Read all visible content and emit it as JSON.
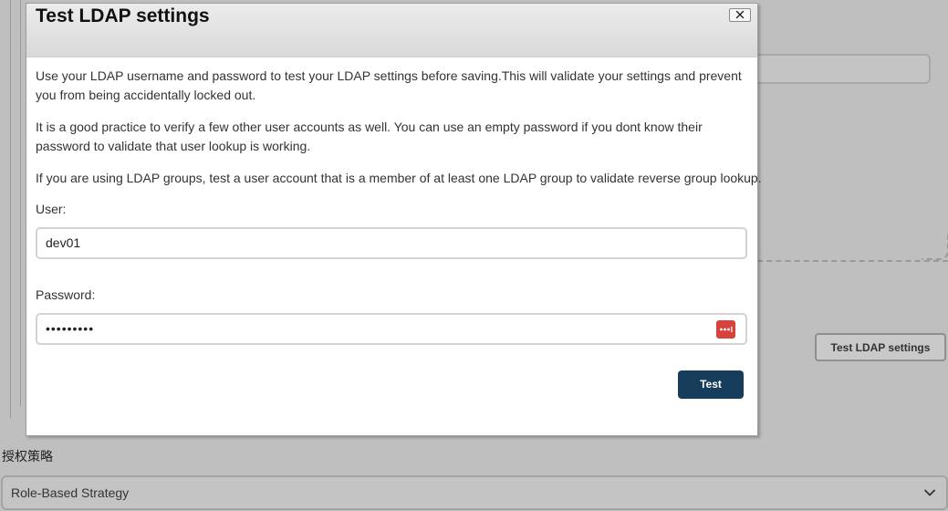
{
  "background": {
    "test_ldap_button_label": "Test LDAP settings",
    "authorization_label": "授权策略",
    "authorization_select_value": "Role-Based Strategy"
  },
  "dialog": {
    "title": "Test LDAP settings",
    "close_label": "✕",
    "paragraphs": {
      "p1": "Use your LDAP username and password to test your LDAP settings before saving.This will validate your settings and prevent you from being accidentally locked out.",
      "p2": "It is a good practice to verify a few other user accounts as well. You can use an empty password if you dont know their password to validate that user lookup is working.",
      "p3": "If you are using LDAP groups, test a user account that is a member of at least one LDAP group to validate reverse group lookup."
    },
    "user_label": "User:",
    "user_value": "dev01",
    "password_label": "Password:",
    "password_value": "•••••••••",
    "test_button_label": "Test"
  },
  "colors": {
    "primary_button": "#163d5c",
    "password_manager_icon": "#d9413b",
    "overlay": "#bfbfbf"
  }
}
